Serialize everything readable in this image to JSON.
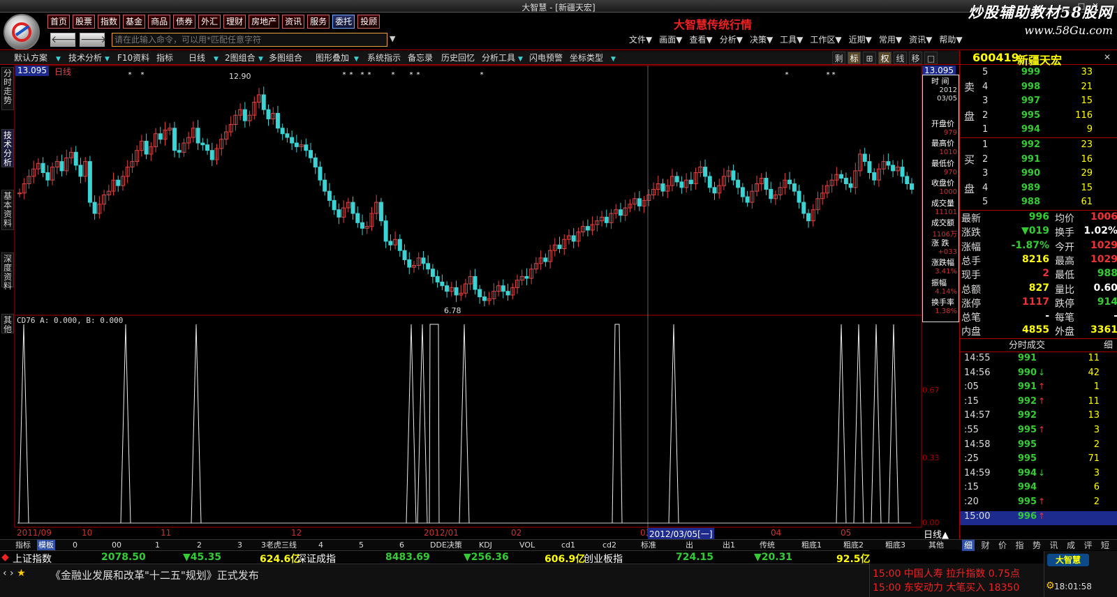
{
  "window": {
    "title": "大智慧 - [新疆天宏]",
    "watermark_line1": "炒股辅助教材58股网",
    "watermark_line2": "www.58Gu.com"
  },
  "nav": {
    "items": [
      "首页",
      "股票",
      "指数",
      "基金",
      "商品",
      "债券",
      "外汇",
      "理财",
      "房地产",
      "资讯",
      "服务",
      "委托",
      "投顾"
    ],
    "highlighted": [
      "委托"
    ],
    "brand": "大智慧传统行情"
  },
  "command": {
    "placeholder": "请在此输入命令，可以用*匹配任意字符"
  },
  "menu": {
    "items": [
      "文件▼",
      "画面▼",
      "查看▼",
      "分析▼",
      "决策▼",
      "工具▼",
      "工作区▼",
      "近期▼",
      "常用▼",
      "资讯▼",
      "帮助▼"
    ]
  },
  "toolbar": {
    "items": [
      "默认方案",
      "技术分析",
      "F10资料",
      "指标",
      "日线",
      "2图组合",
      "多图组合",
      "图形叠加",
      "系统指示",
      "备忘录",
      "历史回忆",
      "分析工具",
      "闪电预警",
      "坐标类型"
    ],
    "right": [
      "剩",
      "标",
      "⊞",
      "权",
      "线",
      "移",
      "□"
    ]
  },
  "side_tabs": [
    "分时走势",
    "技术分析",
    "基本资料",
    "深度资料",
    "其他"
  ],
  "chart": {
    "price_now": "13.095",
    "main_label": "日线",
    "price_high_label": "12.90",
    "price_low_label": "6.78",
    "indicator_title": "CD76  A: 0.000, B: 0.000",
    "axis_right": [
      "0.67",
      "0.33",
      "0.00"
    ],
    "time_labels": [
      "2011/09",
      "10",
      "11",
      "12",
      "2012/01",
      "02",
      "03",
      "04",
      "05"
    ],
    "crosshair_label": "2012/03/05[一]",
    "period_label": "日线▲"
  },
  "info_box": [
    {
      "k": "时  间",
      "v": "2012"
    },
    {
      "k": "",
      "v": "03/05"
    },
    {
      "k": "开盘价",
      "v": "979"
    },
    {
      "k": "最高价",
      "v": "1010"
    },
    {
      "k": "最低价",
      "v": "970"
    },
    {
      "k": "收盘价",
      "v": "1000"
    },
    {
      "k": "成交量",
      "v": "11101"
    },
    {
      "k": "成交额",
      "v": "1106万"
    },
    {
      "k": "涨  跌",
      "v": "+033"
    },
    {
      "k": "涨跌幅",
      "v": "3.41%"
    },
    {
      "k": "振幅",
      "v": "4.14%"
    },
    {
      "k": "换手率",
      "v": "1.38%"
    }
  ],
  "chart_data": {
    "type": "table",
    "title": "新疆天宏 600419 日线",
    "ylim": [
      6.78,
      13.095
    ],
    "candles_ohlc_sample": [
      [
        9.7,
        9.95,
        9.5,
        9.8
      ],
      [
        9.8,
        10.2,
        9.7,
        10.1
      ],
      [
        11.8,
        12.9,
        11.6,
        12.5
      ],
      [
        7.1,
        7.3,
        6.78,
        6.95
      ],
      [
        9.79,
        10.1,
        9.7,
        10.0
      ],
      [
        10.4,
        10.6,
        9.8,
        9.95
      ]
    ],
    "indicator": {
      "name": "CD76",
      "A": 0.0,
      "B": 0.0,
      "levels": [
        0.0,
        0.33,
        0.67,
        1.0
      ]
    }
  },
  "quote": {
    "code": "600419",
    "name": "新疆天宏",
    "sell_label": [
      "卖",
      "盘"
    ],
    "buy_label": [
      "买",
      "盘"
    ],
    "asks": [
      {
        "lv": "5",
        "p": "999",
        "v": "33"
      },
      {
        "lv": "4",
        "p": "998",
        "v": "21"
      },
      {
        "lv": "3",
        "p": "997",
        "v": "15"
      },
      {
        "lv": "2",
        "p": "995",
        "v": "116"
      },
      {
        "lv": "1",
        "p": "994",
        "v": "9"
      }
    ],
    "bids": [
      {
        "lv": "1",
        "p": "992",
        "v": "23"
      },
      {
        "lv": "2",
        "p": "991",
        "v": "16"
      },
      {
        "lv": "3",
        "p": "990",
        "v": "29"
      },
      {
        "lv": "4",
        "p": "989",
        "v": "15"
      },
      {
        "lv": "5",
        "p": "988",
        "v": "61"
      }
    ],
    "stats": [
      {
        "k1": "最新",
        "v1": "996",
        "k2": "均价",
        "v2": "1006"
      },
      {
        "k1": "涨跌",
        "v1": "▼019",
        "k2": "换手",
        "v2": "1.02%"
      },
      {
        "k1": "涨幅",
        "v1": "-1.87%",
        "k2": "今开",
        "v2": "1029"
      },
      {
        "k1": "总手",
        "v1": "8216",
        "k2": "最高",
        "v2": "1029"
      },
      {
        "k1": "现手",
        "v1": "2",
        "k2": "最低",
        "v2": "988"
      },
      {
        "k1": "总额",
        "v1": "827",
        "k2": "量比",
        "v2": "0.60"
      },
      {
        "k1": "涨停",
        "v1": "1117",
        "k2": "跌停",
        "v2": "914"
      },
      {
        "k1": "总笔",
        "v1": "-",
        "k2": "每笔",
        "v2": "-"
      },
      {
        "k1": "内盘",
        "v1": "4855",
        "k2": "外盘",
        "v2": "3361"
      }
    ],
    "trades_title": "分时成交",
    "trades_extra": "细",
    "trades": [
      {
        "t": "14:55",
        "p": "991",
        "a": "",
        "v": "11"
      },
      {
        "t": "14:56",
        "p": "990",
        "a": "↓",
        "v": "42"
      },
      {
        "t": ":05",
        "p": "991",
        "a": "↑",
        "v": "1"
      },
      {
        "t": ":15",
        "p": "992",
        "a": "↑",
        "v": "11"
      },
      {
        "t": "14:57",
        "p": "992",
        "a": "",
        "v": "13"
      },
      {
        "t": ":55",
        "p": "995",
        "a": "↑",
        "v": "3"
      },
      {
        "t": "14:58",
        "p": "995",
        "a": "",
        "v": "2"
      },
      {
        "t": ":25",
        "p": "995",
        "a": "",
        "v": "71"
      },
      {
        "t": "14:59",
        "p": "994",
        "a": "↓",
        "v": "3"
      },
      {
        "t": ":15",
        "p": "994",
        "a": "",
        "v": "6"
      },
      {
        "t": ":20",
        "p": "995",
        "a": "↑",
        "v": "2"
      },
      {
        "t": "15:00",
        "p": "996",
        "a": "↑",
        "v": ""
      }
    ],
    "tabs": [
      "细",
      "财",
      "价",
      "指",
      "势",
      "讯",
      "成",
      "评",
      "短"
    ]
  },
  "bottom_tabs": [
    "指标",
    "模板",
    "0",
    "00",
    "1",
    "2",
    "3",
    "3老虎三线",
    "4",
    "5",
    "6",
    "DDE决策",
    "KDJ",
    "VOL",
    "cd1",
    "cd2",
    "标准",
    "出",
    "出1",
    "传统",
    "粗底1",
    "粗底2",
    "粗底3",
    "其他"
  ],
  "ticker": {
    "sh_name": "上证指数",
    "sh_val": "2078.50",
    "sh_chg": "▼45.35",
    "sh_amt": "624.6亿",
    "sz_name": "深证成指",
    "sz_val": "8483.69",
    "sz_chg": "▼256.36",
    "sz_amt": "606.9亿",
    "cy_name": "创业板指",
    "cy_val": "724.15",
    "cy_chg": "▼20.31",
    "cy_amt": "92.5亿"
  },
  "news": {
    "text": "《金融业发展和改革\"十二五\"规划》正式发布",
    "alert1": "15:00 中国人寿 拉升指数 0.75点",
    "alert2": "15:00 东安动力 大笔买入 18350",
    "logo": "大智慧",
    "clock": "18:01:58"
  }
}
